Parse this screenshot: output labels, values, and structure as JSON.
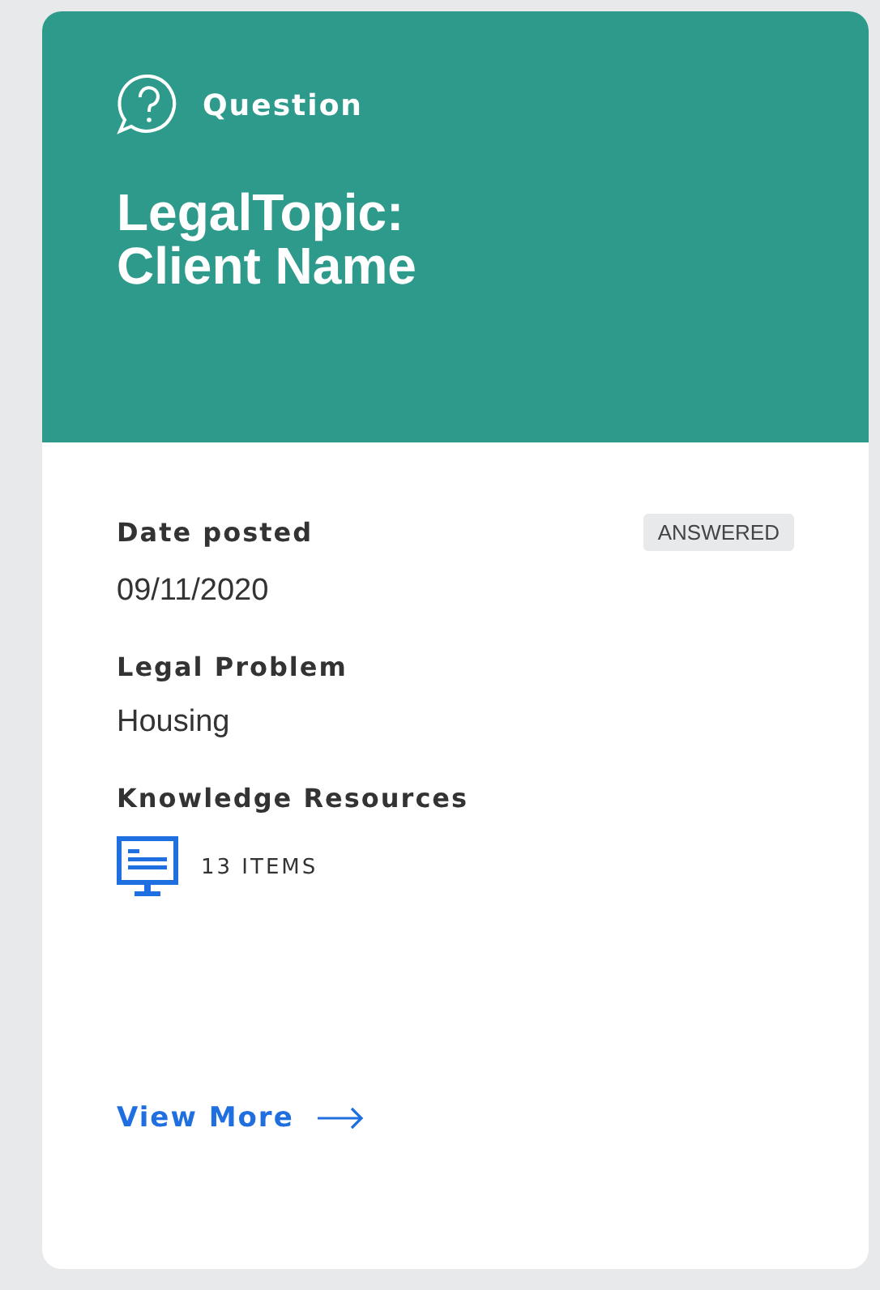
{
  "card": {
    "type_label": "Question",
    "title_lines": [
      "LegalTopic:",
      "Client Name"
    ],
    "fields": [
      {
        "label": "Date posted",
        "value": "09/11/2020",
        "badge": "ANSWERED"
      },
      {
        "label": "Legal Problem",
        "value": "Housing"
      }
    ],
    "resources": {
      "label": "Knowledge Resources",
      "count": "13 ITEMS"
    },
    "link": "View More"
  }
}
